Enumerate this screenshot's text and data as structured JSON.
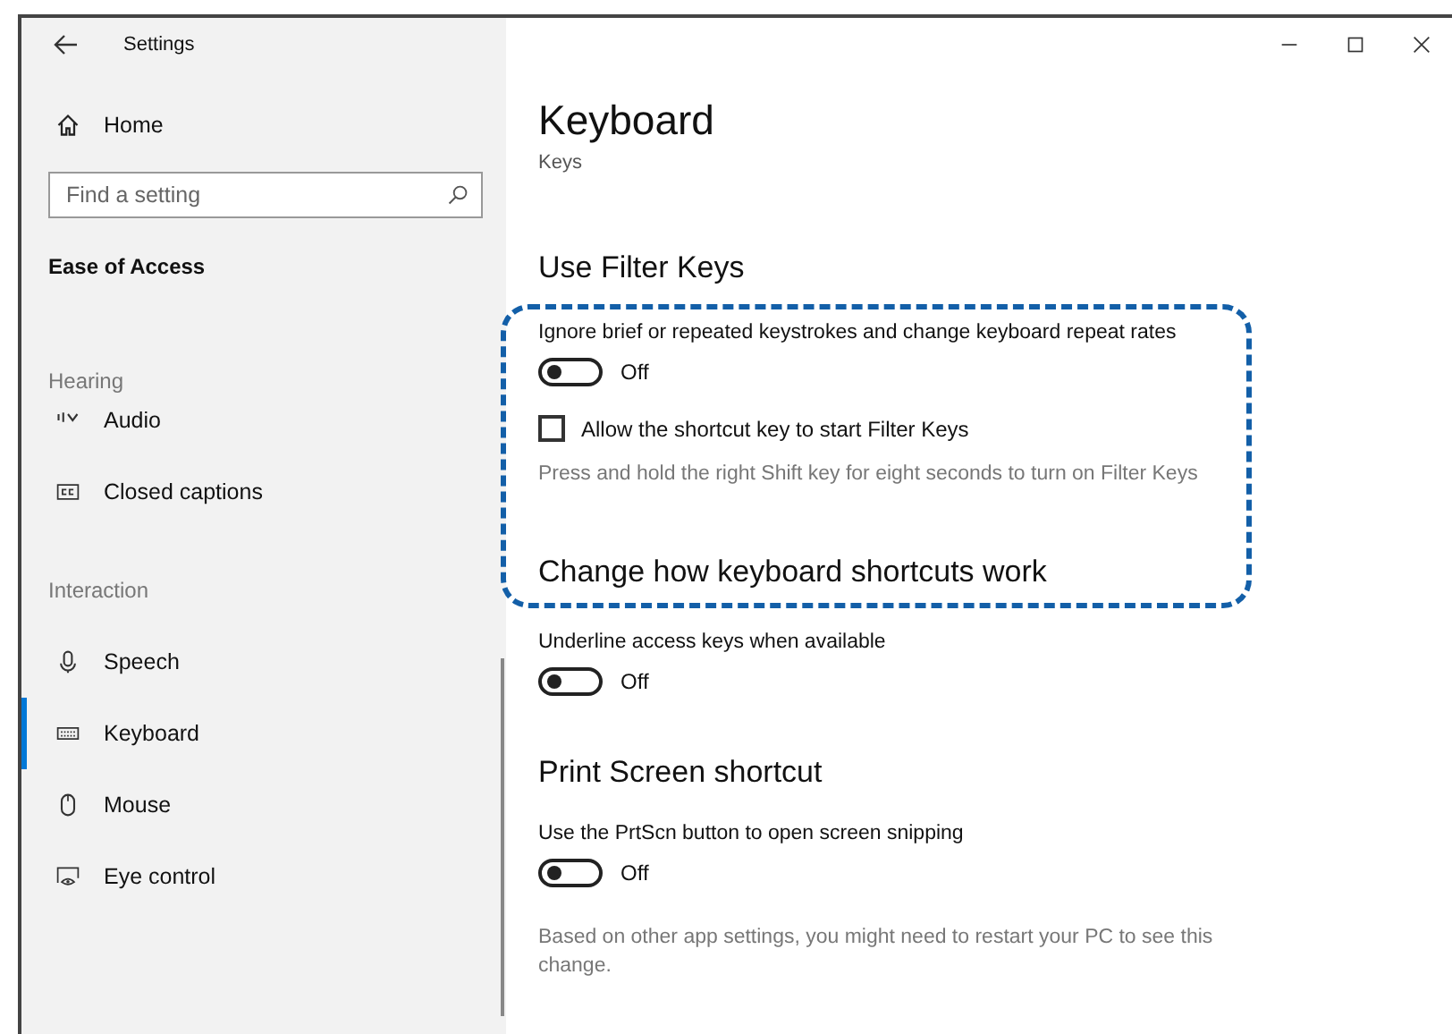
{
  "window": {
    "title": "Settings"
  },
  "sidebar": {
    "home": "Home",
    "search": {
      "placeholder": "Find a setting"
    },
    "category": "Ease of Access",
    "groups": [
      {
        "heading": "Hearing",
        "items": [
          {
            "label": "Audio",
            "selected": false
          },
          {
            "label": "Closed captions",
            "selected": false
          }
        ]
      },
      {
        "heading": "Interaction",
        "items": [
          {
            "label": "Speech",
            "selected": false
          },
          {
            "label": "Keyboard",
            "selected": true
          },
          {
            "label": "Mouse",
            "selected": false
          },
          {
            "label": "Eye control",
            "selected": false
          }
        ]
      }
    ]
  },
  "page": {
    "title": "Keyboard",
    "subtitle": "Keys",
    "sections": [
      {
        "heading": "Use Filter Keys",
        "settings": [
          {
            "kind": "toggle",
            "label": "Ignore brief or repeated keystrokes and change keyboard repeat rates",
            "on": false,
            "state_text": "Off"
          },
          {
            "kind": "checkbox",
            "label": "Allow the shortcut key to start Filter Keys",
            "checked": false
          },
          {
            "kind": "hint",
            "text": "Press and hold the right Shift key for eight seconds to turn on Filter Keys"
          }
        ]
      },
      {
        "heading": "Change how keyboard shortcuts work",
        "settings": [
          {
            "kind": "toggle",
            "label": "Underline access keys when available",
            "on": false,
            "state_text": "Off"
          }
        ]
      },
      {
        "heading": "Print Screen shortcut",
        "settings": [
          {
            "kind": "toggle",
            "label": "Use the PrtScn button to open screen snipping",
            "on": false,
            "state_text": "Off"
          },
          {
            "kind": "hint",
            "text": "Based on other app settings, you might need to restart your PC to see this change."
          }
        ]
      }
    ]
  }
}
